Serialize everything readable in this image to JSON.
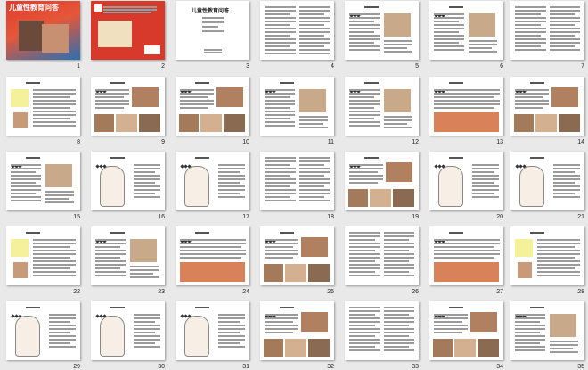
{
  "slides": [
    {
      "number": "1",
      "kind": "cover",
      "title": "儿童性教育问答"
    },
    {
      "number": "2",
      "kind": "backcover"
    },
    {
      "number": "3",
      "kind": "titlepage",
      "title": "儿童性教育问答"
    },
    {
      "number": "4",
      "kind": "toc"
    },
    {
      "number": "5",
      "kind": "text-img"
    },
    {
      "number": "6",
      "kind": "text-img"
    },
    {
      "number": "7",
      "kind": "text"
    },
    {
      "number": "8",
      "kind": "yellow-text"
    },
    {
      "number": "9",
      "kind": "photos"
    },
    {
      "number": "10",
      "kind": "photos"
    },
    {
      "number": "11",
      "kind": "text-img"
    },
    {
      "number": "12",
      "kind": "text-img"
    },
    {
      "number": "13",
      "kind": "photo-wide"
    },
    {
      "number": "14",
      "kind": "photos"
    },
    {
      "number": "15",
      "kind": "text-img"
    },
    {
      "number": "16",
      "kind": "drawing"
    },
    {
      "number": "17",
      "kind": "drawing"
    },
    {
      "number": "18",
      "kind": "text"
    },
    {
      "number": "19",
      "kind": "photos"
    },
    {
      "number": "20",
      "kind": "drawing"
    },
    {
      "number": "21",
      "kind": "drawing"
    },
    {
      "number": "22",
      "kind": "yellow-text"
    },
    {
      "number": "23",
      "kind": "text-img"
    },
    {
      "number": "24",
      "kind": "photo-wide"
    },
    {
      "number": "25",
      "kind": "photos"
    },
    {
      "number": "26",
      "kind": "text"
    },
    {
      "number": "27",
      "kind": "photo-wide"
    },
    {
      "number": "28",
      "kind": "yellow-text"
    },
    {
      "number": "29",
      "kind": "drawing"
    },
    {
      "number": "30",
      "kind": "drawing"
    },
    {
      "number": "31",
      "kind": "drawing"
    },
    {
      "number": "32",
      "kind": "photos"
    },
    {
      "number": "33",
      "kind": "text"
    },
    {
      "number": "34",
      "kind": "photos"
    },
    {
      "number": "35",
      "kind": "text-img"
    }
  ],
  "colors": {
    "background": "#e9e9e9",
    "slide": "#ffffff",
    "highlight": "#f5f19a",
    "cover_red": "#d7392b"
  }
}
